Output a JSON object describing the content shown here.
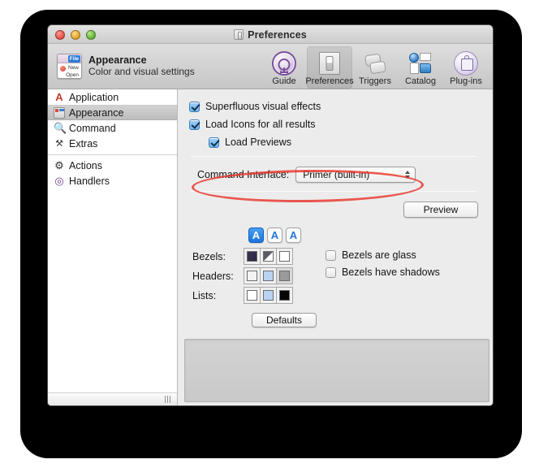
{
  "window": {
    "title": "Preferences",
    "title_icon": "switch-icon",
    "traffic_lights": [
      "close",
      "minimize",
      "zoom"
    ]
  },
  "header": {
    "icon": "file-menu-icon",
    "icon_labels": {
      "file": "File",
      "new": "New",
      "open": "Open"
    },
    "title": "Appearance",
    "subtitle": "Color and visual settings"
  },
  "toolbar": {
    "items": [
      {
        "label": "Guide",
        "icon": "mercury-circle-icon",
        "selected": false
      },
      {
        "label": "Preferences",
        "icon": "light-switch-icon",
        "selected": true
      },
      {
        "label": "Triggers",
        "icon": "stacked-cards-icon",
        "selected": false
      },
      {
        "label": "Catalog",
        "icon": "globe-folder-icon",
        "selected": false
      },
      {
        "label": "Plug-ins",
        "icon": "puzzle-piece-icon",
        "selected": false
      }
    ]
  },
  "sidebar": {
    "group_one": [
      {
        "label": "Application",
        "icon": "application-icon",
        "glyph": "A",
        "selected": false
      },
      {
        "label": "Appearance",
        "icon": "appearance-icon",
        "glyph": "",
        "selected": true
      },
      {
        "label": "Command",
        "icon": "magnifier-icon",
        "glyph": "Q",
        "selected": false
      },
      {
        "label": "Extras",
        "icon": "tools-icon",
        "glyph": "⚒",
        "selected": false
      }
    ],
    "group_two": [
      {
        "label": "Actions",
        "icon": "gear-icon",
        "glyph": "⚙",
        "selected": false
      },
      {
        "label": "Handlers",
        "icon": "target-icon",
        "glyph": "◎",
        "selected": false
      }
    ]
  },
  "main": {
    "checkboxes": [
      {
        "label": "Superfluous visual effects",
        "checked": true,
        "indent": false
      },
      {
        "label": "Load Icons for all results",
        "checked": true,
        "indent": false
      },
      {
        "label": "Load Previews",
        "checked": true,
        "indent": true
      }
    ],
    "command_interface": {
      "label": "Command Interface:",
      "value": "Primer (built-in)",
      "options": [
        "Primer (built-in)"
      ]
    },
    "annotation": {
      "shape": "ellipse",
      "color": "#e8352a"
    },
    "preview_button": "Preview",
    "text_sizes": [
      {
        "label": "A",
        "selected": true
      },
      {
        "label": "A",
        "selected": false
      },
      {
        "label": "A",
        "selected": false
      }
    ],
    "swatch_rows": [
      {
        "label": "Bezels:",
        "cells": [
          {
            "style": "chip-navy",
            "selected": false
          },
          {
            "style": "chip-diag",
            "selected": false
          },
          {
            "style": "chip-white",
            "selected": false
          }
        ]
      },
      {
        "label": "Headers:",
        "cells": [
          {
            "style": "chip-light",
            "selected": false
          },
          {
            "style": "chip-blue",
            "selected": false
          },
          {
            "style": "chip-gray",
            "selected": true
          }
        ]
      },
      {
        "label": "Lists:",
        "cells": [
          {
            "style": "chip-white",
            "selected": false
          },
          {
            "style": "chip-blue",
            "selected": false
          },
          {
            "style": "chip-black",
            "selected": false
          }
        ]
      }
    ],
    "bezel_options": [
      {
        "label": "Bezels are glass",
        "checked": false
      },
      {
        "label": "Bezels have shadows",
        "checked": false
      }
    ],
    "defaults_button": "Defaults"
  }
}
